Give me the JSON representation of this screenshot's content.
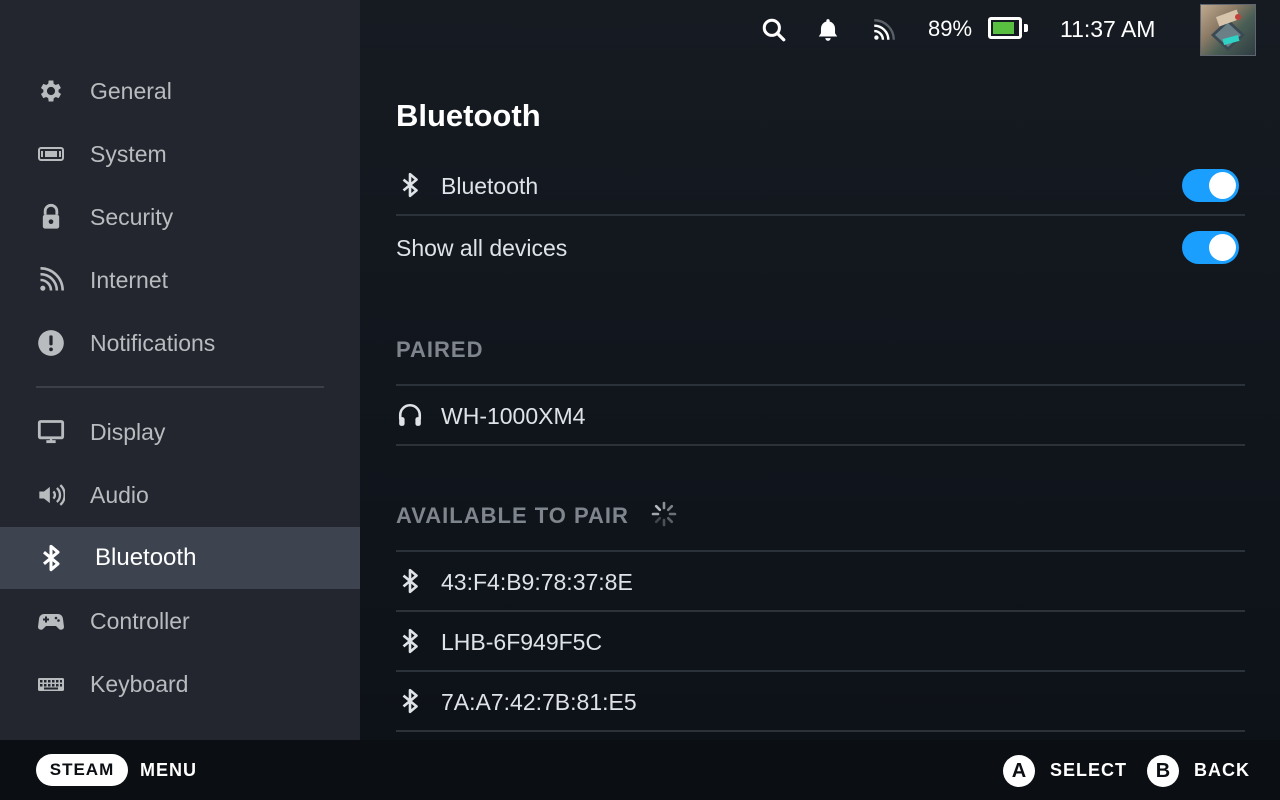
{
  "sidebar": {
    "items": [
      {
        "label": "General",
        "icon": "gear-icon"
      },
      {
        "label": "System",
        "icon": "system-icon"
      },
      {
        "label": "Security",
        "icon": "lock-icon"
      },
      {
        "label": "Internet",
        "icon": "wifi-icon"
      },
      {
        "label": "Notifications",
        "icon": "alert-icon"
      },
      {
        "label": "Display",
        "icon": "monitor-icon"
      },
      {
        "label": "Audio",
        "icon": "speaker-icon"
      },
      {
        "label": "Bluetooth",
        "icon": "bluetooth-icon"
      },
      {
        "label": "Controller",
        "icon": "gamepad-icon"
      },
      {
        "label": "Keyboard",
        "icon": "keyboard-icon"
      }
    ],
    "active": "Bluetooth"
  },
  "topbar": {
    "battery_percent": "89%",
    "battery_level": 0.89,
    "time": "11:37 AM"
  },
  "page": {
    "title": "Bluetooth",
    "toggles": [
      {
        "label": "Bluetooth",
        "on": true
      },
      {
        "label": "Show all devices",
        "on": true
      }
    ],
    "paired_header": "PAIRED",
    "paired": [
      {
        "name": "WH-1000XM4",
        "icon": "headphones-icon"
      }
    ],
    "available_header": "AVAILABLE TO PAIR",
    "available": [
      {
        "name": "43:F4:B9:78:37:8E",
        "icon": "bluetooth-icon"
      },
      {
        "name": "LHB-6F949F5C",
        "icon": "bluetooth-icon"
      },
      {
        "name": "7A:A7:42:7B:81:E5",
        "icon": "bluetooth-icon"
      }
    ]
  },
  "footer": {
    "steam_label": "STEAM",
    "menu_label": "MENU",
    "a_button": "A",
    "select_label": "SELECT",
    "b_button": "B",
    "back_label": "BACK"
  },
  "colors": {
    "accent": "#1a9fff",
    "battery": "#59bf40",
    "sidebar_bg": "#23262e",
    "active_bg": "#3d4450"
  }
}
